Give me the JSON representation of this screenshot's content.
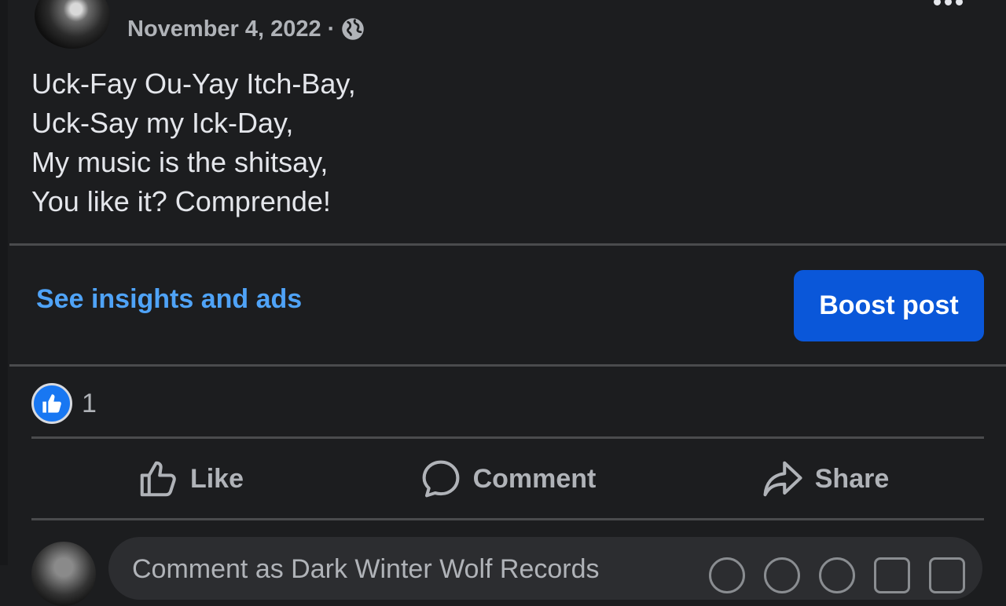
{
  "post": {
    "date": "November 4, 2022",
    "separator": "·",
    "privacy_icon": "globe-icon",
    "lines": [
      "Uck-Fay Ou-Yay Itch-Bay,",
      "Uck-Say my Ick-Day,",
      "My music is the shitsay,",
      "You like it? Comprende!"
    ]
  },
  "promo": {
    "insights_label": "See insights and ads",
    "boost_label": "Boost post"
  },
  "reactions": {
    "icon": "like-reaction-icon",
    "count": "1"
  },
  "actions": {
    "like": "Like",
    "comment": "Comment",
    "share": "Share"
  },
  "comment_composer": {
    "placeholder": "Comment as Dark Winter Wolf Records"
  },
  "colors": {
    "background": "#1c1d1f",
    "link": "#4fa3f7",
    "primary_button": "#0a57d9",
    "like_badge": "#1877f2"
  }
}
